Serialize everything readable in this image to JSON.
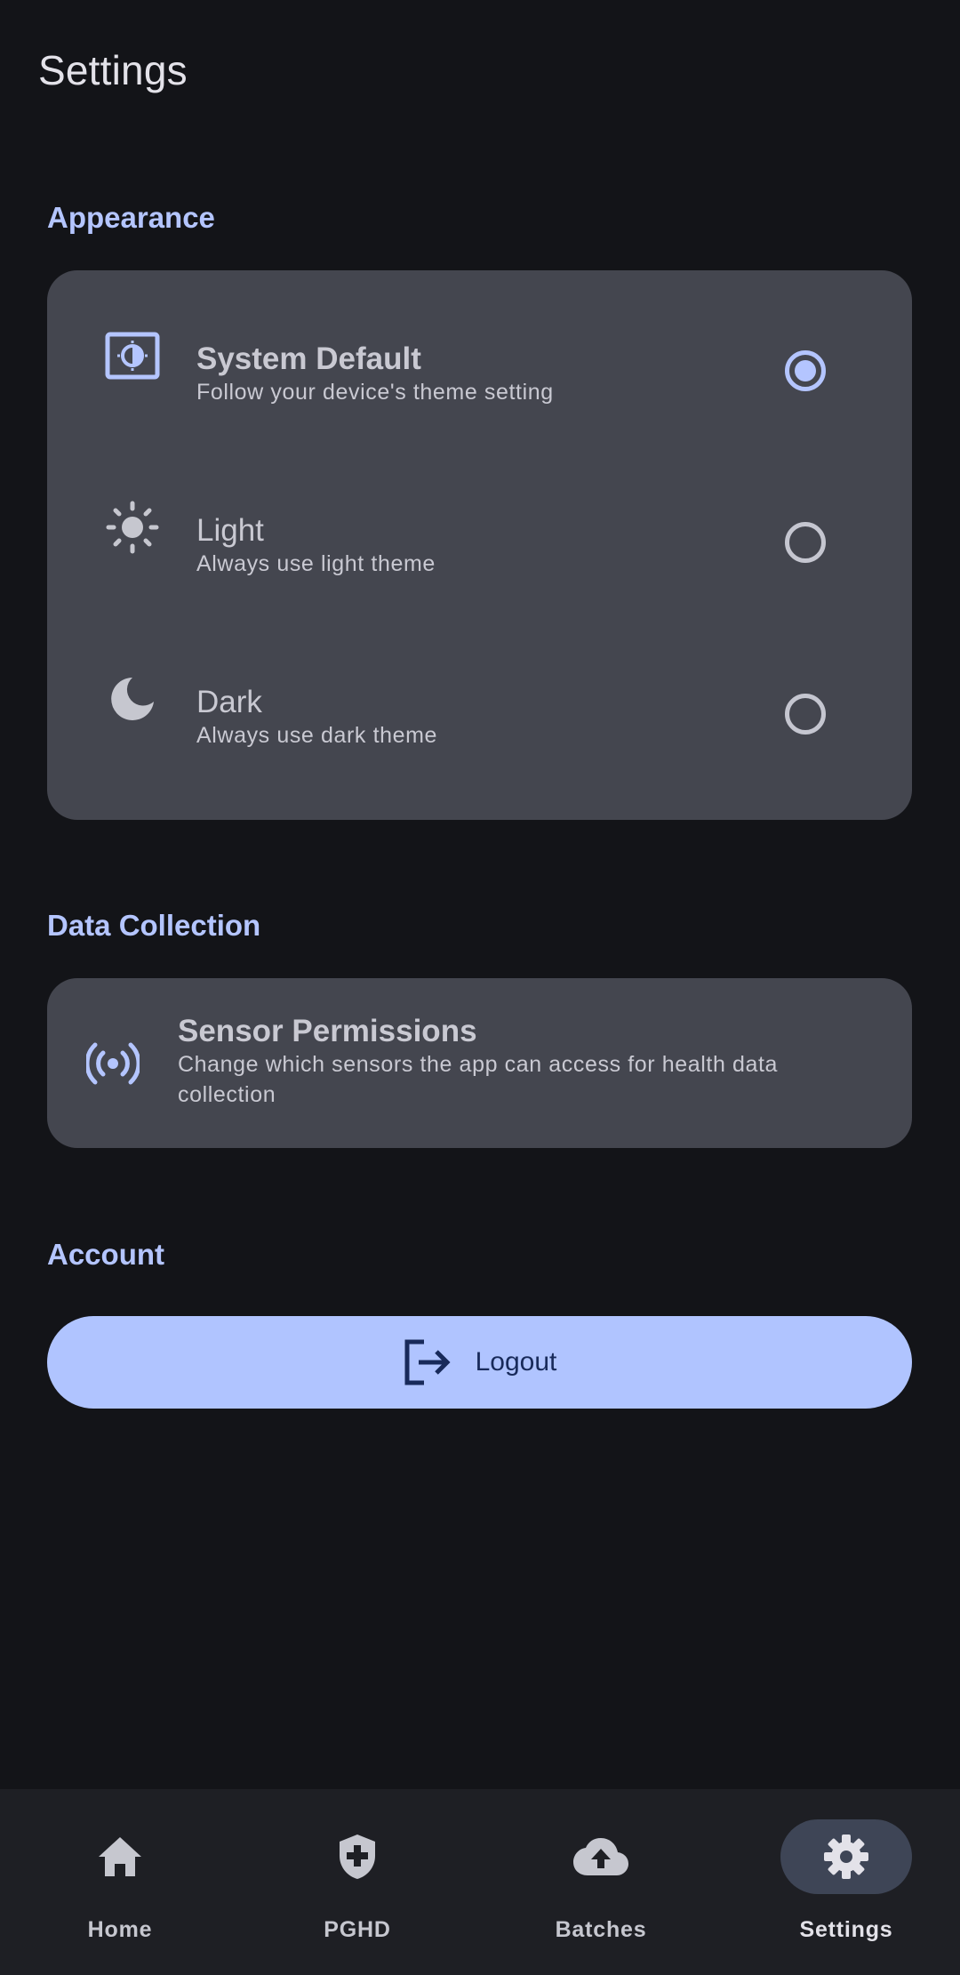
{
  "page": {
    "title": "Settings"
  },
  "sections": {
    "appearance": {
      "header": "Appearance",
      "options": [
        {
          "title": "System Default",
          "subtitle": "Follow your device's theme setting",
          "icon": "brightness-auto-icon",
          "selected": true
        },
        {
          "title": "Light",
          "subtitle": "Always use light theme",
          "icon": "sun-icon",
          "selected": false
        },
        {
          "title": "Dark",
          "subtitle": "Always use dark theme",
          "icon": "moon-icon",
          "selected": false
        }
      ]
    },
    "data_collection": {
      "header": "Data Collection",
      "sensor_permissions": {
        "title": "Sensor Permissions",
        "subtitle": "Change which sensors the app can access for health data collection",
        "icon": "sensors-icon"
      }
    },
    "account": {
      "header": "Account",
      "logout_label": "Logout",
      "logout_icon": "logout-icon"
    }
  },
  "bottom_nav": {
    "items": [
      {
        "label": "Home",
        "icon": "home-icon",
        "active": false
      },
      {
        "label": "PGHD",
        "icon": "shield-plus-icon",
        "active": false
      },
      {
        "label": "Batches",
        "icon": "cloud-upload-icon",
        "active": false
      },
      {
        "label": "Settings",
        "icon": "gear-icon",
        "active": true
      }
    ]
  },
  "colors": {
    "background": "#131418",
    "card": "#44464F",
    "accent": "#B4C5FF",
    "button": "#B0C4FF",
    "nav_background": "#1E1F24",
    "nav_active_pill": "#3E4556"
  }
}
